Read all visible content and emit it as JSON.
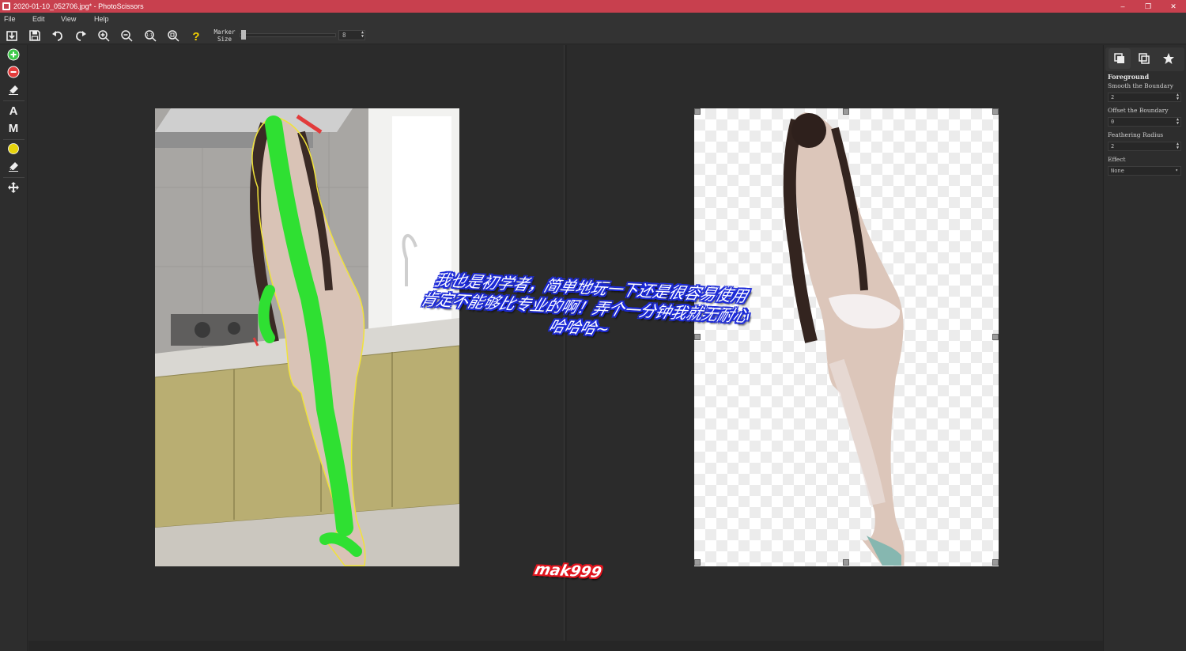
{
  "window": {
    "title": "2020-01-10_052706.jpg* - PhotoScissors",
    "controls": [
      "–",
      "❐",
      "✕"
    ]
  },
  "menu": [
    "File",
    "Edit",
    "View",
    "Help"
  ],
  "toolbar": {
    "buttons": [
      "open-icon",
      "save-icon",
      "undo-icon",
      "redo-icon",
      "zoom-in-icon",
      "zoom-out-icon",
      "zoom-actual-icon",
      "zoom-fit-icon",
      "help-icon"
    ],
    "marker_label_line1": "Marker",
    "marker_label_line2": "Size",
    "marker_value": "8",
    "marker_level_fraction": 0.02
  },
  "left_tools": {
    "buttons": [
      "foreground-marker-icon",
      "background-marker-icon",
      "eraser-icon",
      "text-tool",
      "mask-tool",
      "color-picker-icon",
      "eraser-2-icon",
      "move-icon"
    ],
    "text_tool_label": "A",
    "mask_tool_label": "M",
    "accent_green": "#3ec84a",
    "accent_red": "#e23b3b",
    "accent_yellow": "#e6d30c"
  },
  "right_panel": {
    "tabs": [
      "copy-icon",
      "duplicate-icon",
      "star-icon"
    ],
    "section": "Foreground",
    "fields": [
      {
        "label": "Smooth the Boundary",
        "value": "2"
      },
      {
        "label": "Offset the Boundary",
        "value": "0"
      },
      {
        "label": "Feathering Radius",
        "value": "2"
      }
    ],
    "effect_label": "Effect",
    "effect_value": "None"
  },
  "overlay": {
    "caption_lines": [
      "我也是初学者，简单地玩一下还是很容易使用",
      "肯定不能够比专业的啊！弄个一分钟我就无耐心",
      "哈哈哈~"
    ],
    "watermark": "mak999"
  },
  "colors": {
    "title_bar": "#c8404e",
    "marker_green": "#2fe032",
    "outline_yellow": "#f0e33a",
    "caption_outline": "#1c2ad8",
    "watermark_outline": "#e0141d"
  }
}
